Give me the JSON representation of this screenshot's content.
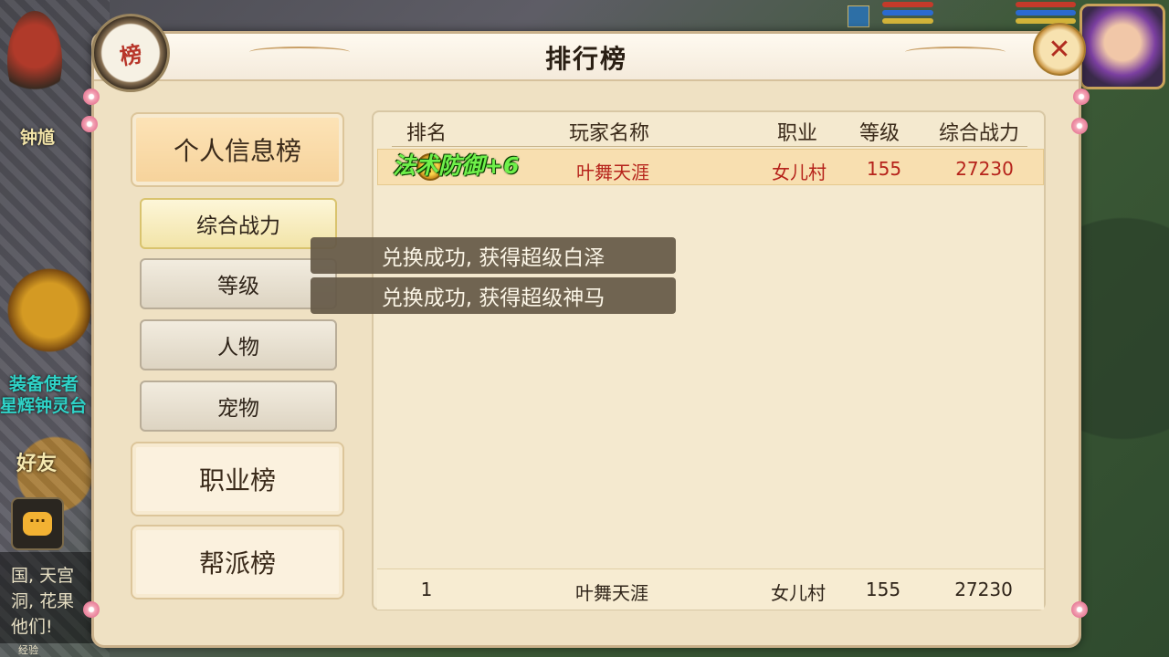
{
  "world": {
    "npc_zhongkui": "钟馗",
    "npc_equip_envoy": "装备使者",
    "npc_star_bell": "星辉钟灵台",
    "friends_label": "好友",
    "chat_text": "国, 天宫\n洞, 花果\n他们!",
    "exp_label": "经验",
    "chat_icon": "chat-bubble-icon"
  },
  "panel": {
    "title": "排行榜",
    "badge_char": "榜",
    "close_icon": "close-x-icon"
  },
  "nav": {
    "personal": "个人信息榜",
    "combat": "综合战力",
    "level": "等级",
    "character": "人物",
    "pet": "宠物",
    "profession": "职业榜",
    "guild": "帮派榜"
  },
  "table": {
    "headers": {
      "rank": "排名",
      "player": "玩家名称",
      "profession": "职业",
      "level": "等级",
      "power": "综合战力"
    },
    "rows": [
      {
        "rank_icon": "gold-medal-icon",
        "player": "叶舞天涯",
        "profession": "女儿村",
        "level": "155",
        "power": "27230"
      }
    ],
    "my_row": {
      "rank": "1",
      "player": "叶舞天涯",
      "profession": "女儿村",
      "level": "155",
      "power": "27230"
    }
  },
  "overlays": {
    "float_text": "法术防御+6",
    "toast1": "兑换成功, 获得超级白泽",
    "toast2": "兑换成功, 获得超级神马"
  },
  "colors": {
    "highlight_row": "#f8dfb0",
    "rank_text_red": "#b6231b",
    "float_green": "#6ff04a"
  }
}
